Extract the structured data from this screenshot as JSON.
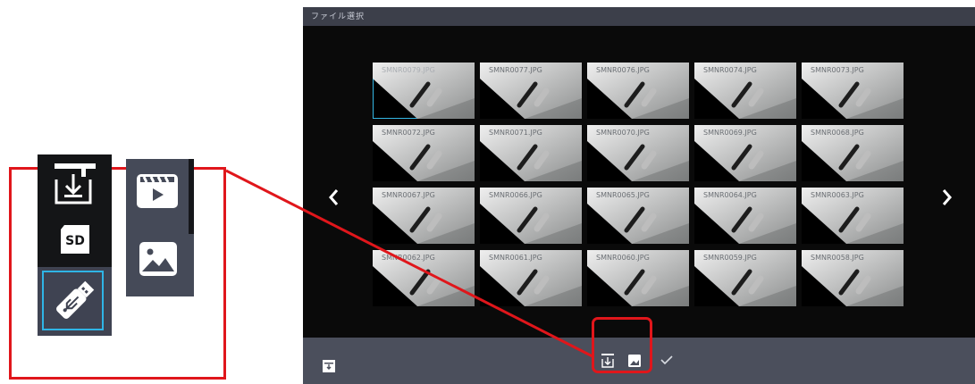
{
  "window": {
    "title": "ファイル選択"
  },
  "thumbnails": [
    {
      "name": "SMNR0079.JPG",
      "selected": true
    },
    {
      "name": "SMNR0077.JPG"
    },
    {
      "name": "SMNR0076.JPG"
    },
    {
      "name": "SMNR0074.JPG"
    },
    {
      "name": "SMNR0073.JPG"
    },
    {
      "name": "SMNR0072.JPG"
    },
    {
      "name": "SMNR0071.JPG"
    },
    {
      "name": "SMNR0070.JPG"
    },
    {
      "name": "SMNR0069.JPG"
    },
    {
      "name": "SMNR0068.JPG"
    },
    {
      "name": "SMNR0067.JPG"
    },
    {
      "name": "SMNR0066.JPG"
    },
    {
      "name": "SMNR0065.JPG"
    },
    {
      "name": "SMNR0064.JPG"
    },
    {
      "name": "SMNR0063.JPG"
    },
    {
      "name": "SMNR0062.JPG"
    },
    {
      "name": "SMNR0061.JPG"
    },
    {
      "name": "SMNR0060.JPG"
    },
    {
      "name": "SMNR0059.JPG"
    },
    {
      "name": "SMNR0058.JPG"
    }
  ],
  "callout": {
    "storage_options": [
      {
        "icon": "internal-storage-icon"
      },
      {
        "icon": "sd-card-icon",
        "label": "SD"
      },
      {
        "icon": "usb-drive-icon",
        "selected": true
      }
    ],
    "media_options": [
      {
        "icon": "video-icon"
      },
      {
        "icon": "image-icon"
      }
    ]
  },
  "colors": {
    "accent": "#2fb5e6",
    "annotation": "#e0161b",
    "bar": "#4b4f5c",
    "titlebar": "#3c3f4a"
  }
}
